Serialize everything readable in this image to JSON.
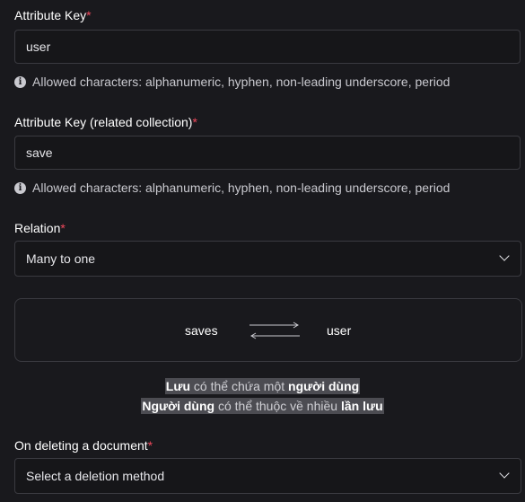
{
  "attribute_key": {
    "label": "Attribute Key",
    "required_mark": "*",
    "value": "user",
    "helper": "Allowed characters: alphanumeric, hyphen, non-leading underscore, period"
  },
  "related_key": {
    "label": "Attribute Key (related collection)",
    "required_mark": "*",
    "value": "save",
    "helper": "Allowed characters: alphanumeric, hyphen, non-leading underscore, period"
  },
  "relation": {
    "label": "Relation",
    "required_mark": "*",
    "selected": "Many to one"
  },
  "diagram": {
    "left": "saves",
    "right": "user",
    "arrow_icon": "bidirectional-arrows-icon"
  },
  "summary": {
    "line1": {
      "bold1": "Lưu",
      "mid": " có thể chứa một ",
      "bold2": "người dùng"
    },
    "line2": {
      "bold1": "Người dùng",
      "mid": " có thể thuộc về nhiều ",
      "bold2": "lần lưu"
    }
  },
  "on_delete": {
    "label": "On deleting a document",
    "required_mark": "*",
    "placeholder": "Select a deletion method"
  },
  "colors": {
    "background": "#19191d",
    "required": "#f0485c",
    "border": "#3a3a40",
    "highlight": "#4c4c52"
  }
}
